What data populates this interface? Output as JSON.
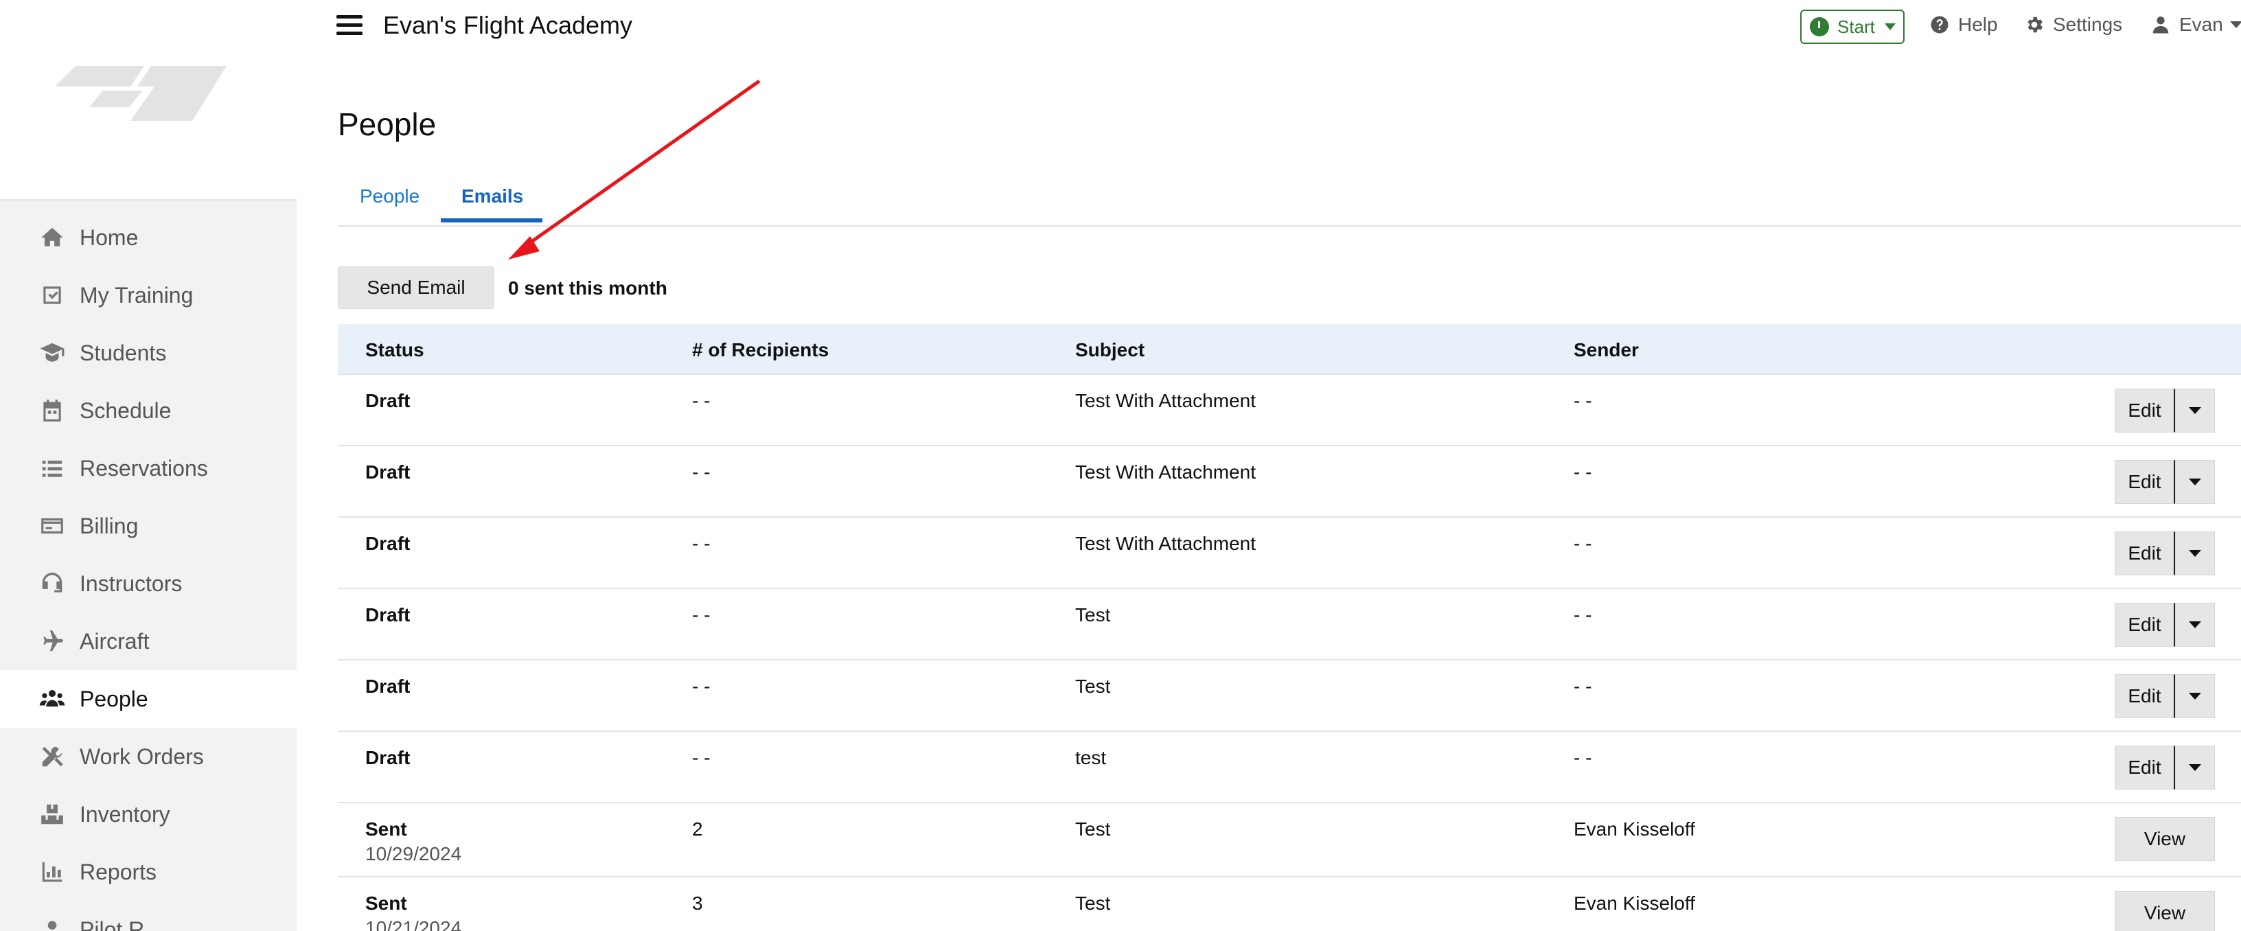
{
  "header": {
    "app_title": "Evan's Flight Academy",
    "start_label": "Start",
    "help_label": "Help",
    "settings_label": "Settings",
    "user_label": "Evan"
  },
  "sidebar": {
    "items": [
      {
        "label": "Home",
        "icon": "home-icon"
      },
      {
        "label": "My Training",
        "icon": "checkbox-icon"
      },
      {
        "label": "Students",
        "icon": "graduation-cap-icon"
      },
      {
        "label": "Schedule",
        "icon": "calendar-icon"
      },
      {
        "label": "Reservations",
        "icon": "list-icon"
      },
      {
        "label": "Billing",
        "icon": "credit-card-icon"
      },
      {
        "label": "Instructors",
        "icon": "headset-icon"
      },
      {
        "label": "Aircraft",
        "icon": "plane-icon"
      },
      {
        "label": "People",
        "icon": "users-icon",
        "active": true
      },
      {
        "label": "Work Orders",
        "icon": "tools-icon"
      },
      {
        "label": "Inventory",
        "icon": "boxes-icon"
      },
      {
        "label": "Reports",
        "icon": "chart-icon"
      },
      {
        "label": "Pilot R...",
        "icon": "pilot-icon"
      }
    ]
  },
  "main": {
    "page_title": "People",
    "tabs": [
      {
        "label": "People"
      },
      {
        "label": "Emails",
        "active": true
      }
    ],
    "send_email_label": "Send Email",
    "sent_count_text": "0 sent this month"
  },
  "table": {
    "columns": [
      "Status",
      "# of Recipients",
      "Subject",
      "Sender"
    ],
    "rows": [
      {
        "status": "Draft",
        "date": "",
        "recipients": "- -",
        "subject": "Test With Attachment",
        "sender": "- -",
        "action": "Edit"
      },
      {
        "status": "Draft",
        "date": "",
        "recipients": "- -",
        "subject": "Test With Attachment",
        "sender": "- -",
        "action": "Edit"
      },
      {
        "status": "Draft",
        "date": "",
        "recipients": "- -",
        "subject": "Test With Attachment",
        "sender": "- -",
        "action": "Edit"
      },
      {
        "status": "Draft",
        "date": "",
        "recipients": "- -",
        "subject": "Test",
        "sender": "- -",
        "action": "Edit"
      },
      {
        "status": "Draft",
        "date": "",
        "recipients": "- -",
        "subject": "Test",
        "sender": "- -",
        "action": "Edit"
      },
      {
        "status": "Draft",
        "date": "",
        "recipients": "- -",
        "subject": "test",
        "sender": "- -",
        "action": "Edit"
      },
      {
        "status": "Sent",
        "date": "10/29/2024",
        "recipients": "2",
        "subject": "Test",
        "sender": "Evan Kisseloff",
        "action": "View"
      },
      {
        "status": "Sent",
        "date": "10/21/2024",
        "recipients": "3",
        "subject": "Test",
        "sender": "Evan Kisseloff",
        "action": "View"
      }
    ]
  },
  "colors": {
    "accent": "#1565c0",
    "start_green": "#2e7d32",
    "annotation_arrow": "#e8161b",
    "table_header_bg": "#e8f1fa"
  }
}
